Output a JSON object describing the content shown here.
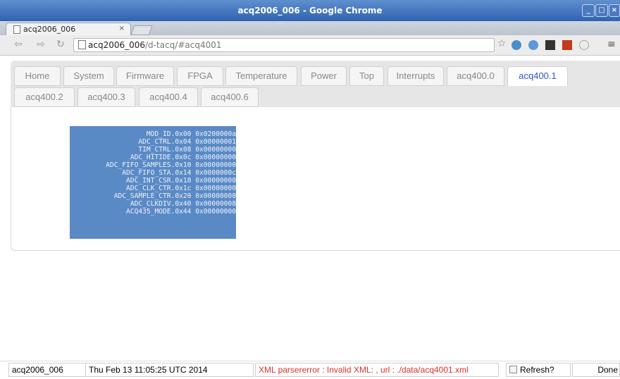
{
  "window": {
    "title": "acq2006_006 - Google Chrome",
    "tab_label": "acq2006_006",
    "tab_close": "×"
  },
  "toolbar": {
    "url_host": "acq2006_006",
    "url_path": "/d-tacq/#acq4001"
  },
  "page_tabs": [
    {
      "label": "Home",
      "active": false
    },
    {
      "label": "System",
      "active": false
    },
    {
      "label": "Firmware",
      "active": false
    },
    {
      "label": "FPGA",
      "active": false
    },
    {
      "label": "Temperature",
      "active": false
    },
    {
      "label": "Power",
      "active": false
    },
    {
      "label": "Top",
      "active": false
    },
    {
      "label": "Interrupts",
      "active": false
    },
    {
      "label": "acq400.0",
      "active": false
    },
    {
      "label": "acq400.1",
      "active": true
    },
    {
      "label": "acq400.2",
      "active": false
    },
    {
      "label": "acq400.3",
      "active": false
    },
    {
      "label": "acq400.4",
      "active": false
    },
    {
      "label": "acq400.6",
      "active": false
    }
  ],
  "registers": [
    {
      "name": "MOD_ID.0x00",
      "value": "0x0200000a"
    },
    {
      "name": "ADC_CTRL.0x04",
      "value": "0x00000001"
    },
    {
      "name": "TIM_CTRL.0x08",
      "value": "0x00000000"
    },
    {
      "name": "ADC_HITIDE.0x0c",
      "value": "0x00000000"
    },
    {
      "name": "ADC_FIFO_SAMPLES.0x10",
      "value": "0x00000000"
    },
    {
      "name": "ADC_FIFO_STA.0x14",
      "value": "0x0000000c"
    },
    {
      "name": "ADC_INT_CSR.0x18",
      "value": "0x00000000"
    },
    {
      "name": "ADC_CLK_CTR.0x1c",
      "value": "0x00000000"
    },
    {
      "name": "ADC_SAMPLE_CTR.0x20",
      "value": "0x00000000"
    },
    {
      "name": "ADC_CLKDIV.0x40",
      "value": "0x00000008"
    },
    {
      "name": "ACQ435_MODE.0x44",
      "value": "0x00000000"
    }
  ],
  "status": {
    "host": "acq2006_006",
    "datetime": "Thu Feb 13 11:05:25 UTC 2014",
    "error": "XML parsererror : Invalid XML: , url : ./data/acq4001.xml",
    "refresh_label": "Refresh?",
    "done": "Done"
  },
  "colors": {
    "titlebar": "#2f63b0",
    "register_panel": "#5a8ac6",
    "active_tab_text": "#3355cc",
    "error_text": "#e0302a"
  },
  "icons": [
    "document-icon",
    "back-icon",
    "forward-icon",
    "reload-icon",
    "star-icon",
    "extension-icons",
    "menu-icon"
  ]
}
